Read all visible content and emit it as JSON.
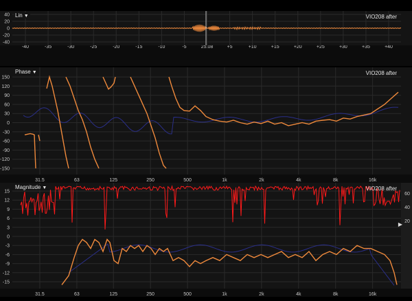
{
  "impulse": {
    "title": "Lin",
    "trace_label": "VIO208 after",
    "y_ticks": [
      "40",
      "20",
      "0",
      "-20",
      "-40"
    ],
    "x_ticks": [
      "-40",
      "-35",
      "-30",
      "-25",
      "-20",
      "-15",
      "-10",
      "-5",
      "25.08",
      "+5",
      "+10",
      "+15",
      "+20",
      "+25",
      "+30",
      "+35",
      "+40"
    ],
    "trace_color": "#f08a3c"
  },
  "phase": {
    "title": "Phase",
    "trace_label": "VIO208 after",
    "y_ticks": [
      "150",
      "120",
      "90",
      "60",
      "30",
      "0",
      "-30",
      "-60",
      "-90",
      "-120",
      "-150"
    ],
    "x_ticks": [
      "31.5",
      "63",
      "125",
      "250",
      "500",
      "1k",
      "2k",
      "4k",
      "8k",
      "16k"
    ],
    "trace_color": "#f08a3c",
    "ref_color": "#2a2f8a"
  },
  "magnitude": {
    "title": "Magnitude",
    "trace_label": "VIO208 after",
    "y_ticks": [
      "15",
      "12",
      "9",
      "6",
      "3",
      "0",
      "-3",
      "-6",
      "-9",
      "-12",
      "-15"
    ],
    "right_ticks": [
      "60",
      "40",
      "20"
    ],
    "x_ticks": [
      "31.5",
      "63",
      "125",
      "250",
      "500",
      "1k",
      "2k",
      "4k",
      "8k",
      "16k"
    ],
    "trace_color": "#f08a3c",
    "coherence_color": "#ff1a1a",
    "ref_color": "#2a2f8a"
  },
  "icons": {
    "caret": "▼",
    "handle": "▶"
  }
}
